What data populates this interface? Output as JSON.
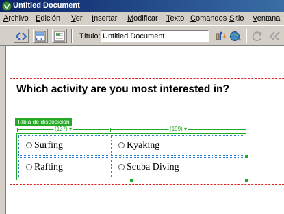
{
  "window": {
    "title": "Untitled Document"
  },
  "menubar": {
    "items": [
      "Archivo",
      "Edición",
      "Ver",
      "Insertar",
      "Modificar",
      "Texto",
      "Comandos",
      "Sitio",
      "Ventana"
    ]
  },
  "toolbar": {
    "title_label": "Título:",
    "title_value": "Untitled Document"
  },
  "document": {
    "question": "Which activity are you most interested in?",
    "layout_tag": "Tabla de disposición",
    "col_widths": [
      "(137) ▾",
      "(199) ▾"
    ],
    "options": [
      "Surfing",
      "Kyaking",
      "Rafting",
      "Scuba Diving"
    ]
  },
  "colors": {
    "titlebar": "#0a246a",
    "layout_green": "#23a923",
    "form_red": "#e02020",
    "cell_blue": "#2a7fd0"
  }
}
